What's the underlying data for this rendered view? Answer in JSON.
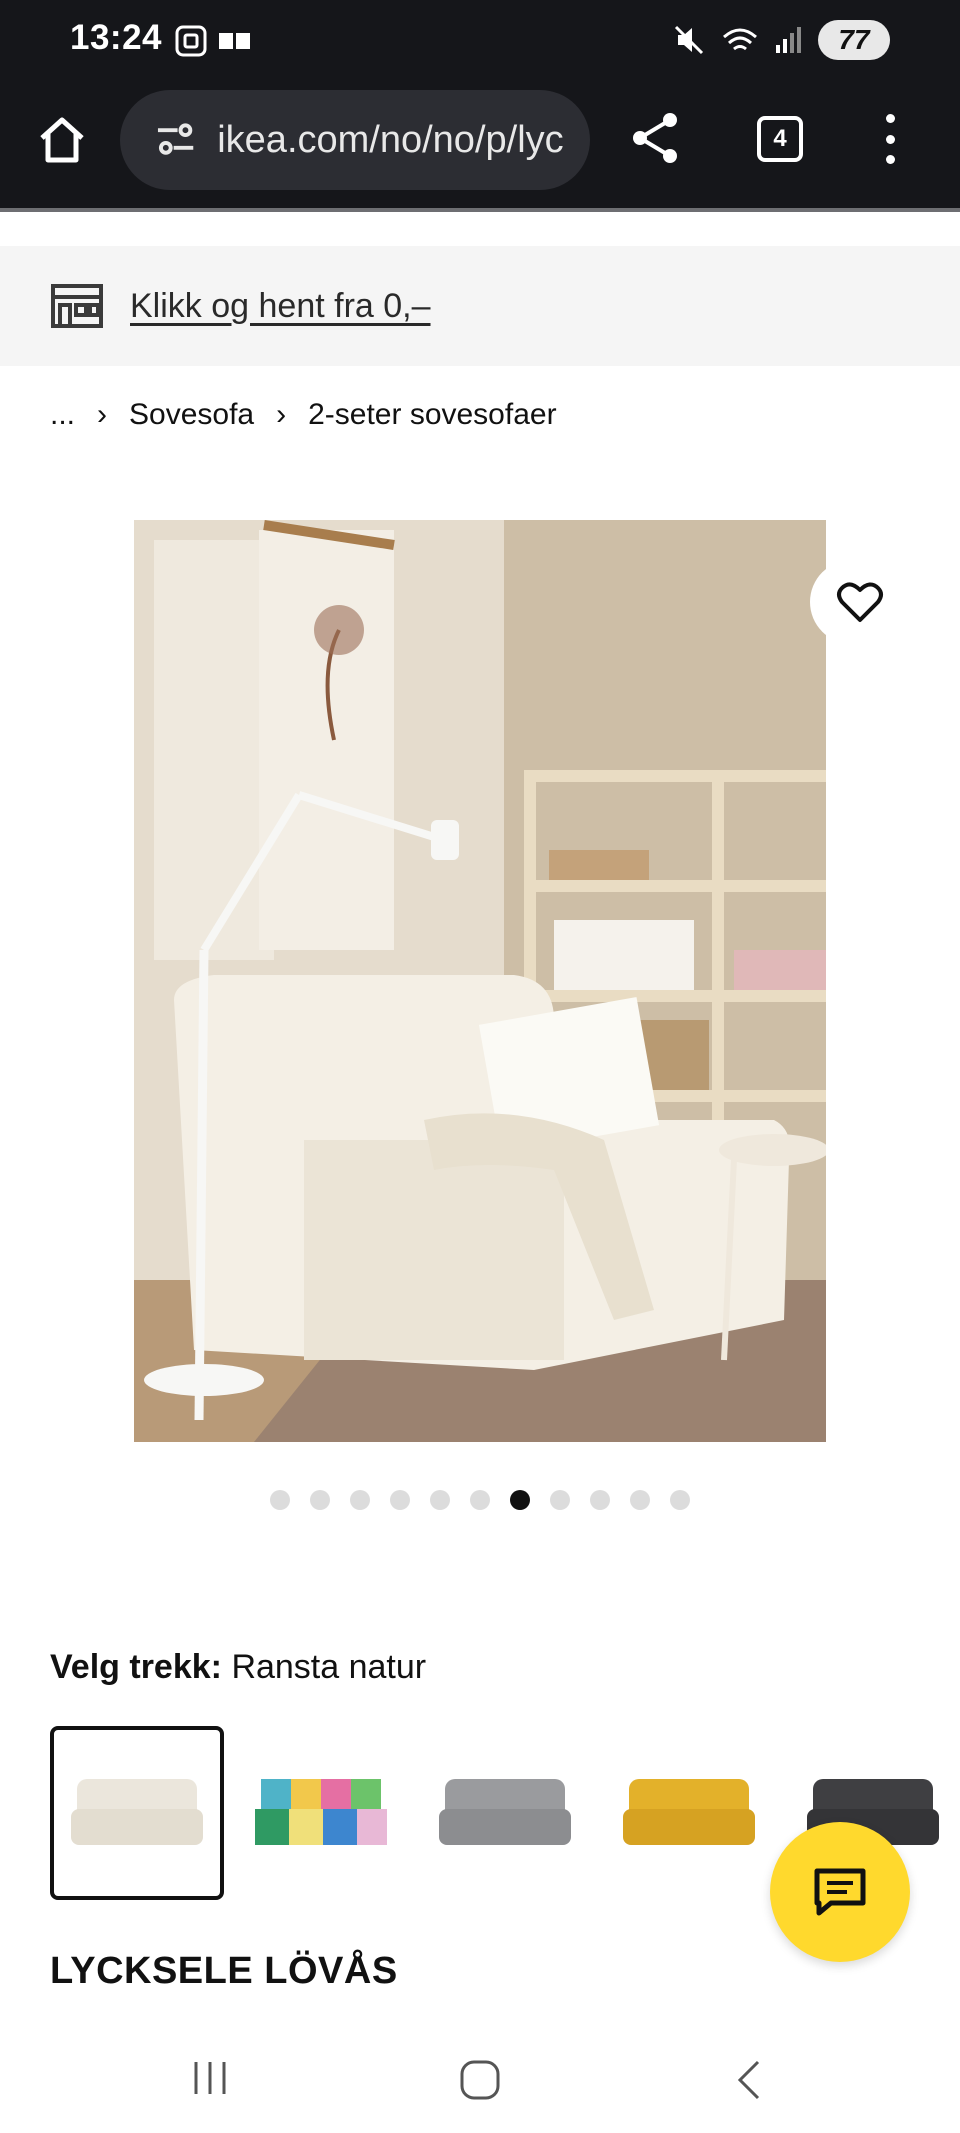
{
  "status_bar": {
    "time": "13:24",
    "battery": "77"
  },
  "browser": {
    "url": "ikea.com/no/no/p/lyc",
    "tab_count": "4"
  },
  "banner": {
    "text": "Klikk og hent fra 0,–"
  },
  "breadcrumb": {
    "items": [
      "...",
      "Sovesofa",
      "2-seter sovesofaer"
    ]
  },
  "gallery": {
    "dot_count": 11,
    "active_index": 6
  },
  "variant": {
    "label": "Velg trekk:",
    "value": "Ransta natur",
    "swatches": [
      {
        "name": "ransta-natur",
        "color": "#ebe6dc"
      },
      {
        "name": "multicolor",
        "color": "#4fb3c8"
      },
      {
        "name": "grey",
        "color": "#9a9b9e"
      },
      {
        "name": "yellow",
        "color": "#e3b12a"
      },
      {
        "name": "dark-grey",
        "color": "#3f3f42"
      }
    ]
  },
  "product": {
    "name": "LYCKSELE LÖVÅS"
  },
  "colors": {
    "accent_yellow": "#ffd92d",
    "browser_bg": "#15161a"
  }
}
